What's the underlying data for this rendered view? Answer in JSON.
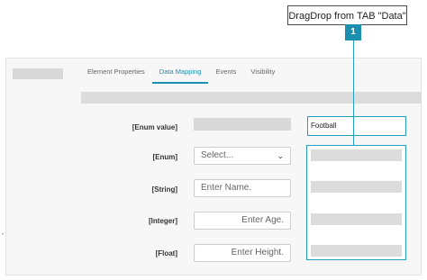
{
  "callout": {
    "text": "DragDrop from TAB \"Data\"",
    "badge": "1"
  },
  "tabs": [
    {
      "label": "Element Properties",
      "active": false
    },
    {
      "label": "Data Mapping",
      "active": true
    },
    {
      "label": "Events",
      "active": false
    },
    {
      "label": "Visibility",
      "active": false
    }
  ],
  "fields": {
    "enum_value": {
      "label": "[Enum value]"
    },
    "enum": {
      "label": "[Enum]",
      "value": "Select..."
    },
    "string": {
      "label": "[String]",
      "placeholder": "Enter Name."
    },
    "integer": {
      "label": "[Integer]",
      "placeholder": "Enter Age."
    },
    "float": {
      "label": "[Float]",
      "placeholder": "Enter Height."
    }
  },
  "mapping": {
    "enum_value_target": "Football"
  },
  "colors": {
    "accent": "#1b8fb0",
    "outline": "#24a0c0"
  }
}
